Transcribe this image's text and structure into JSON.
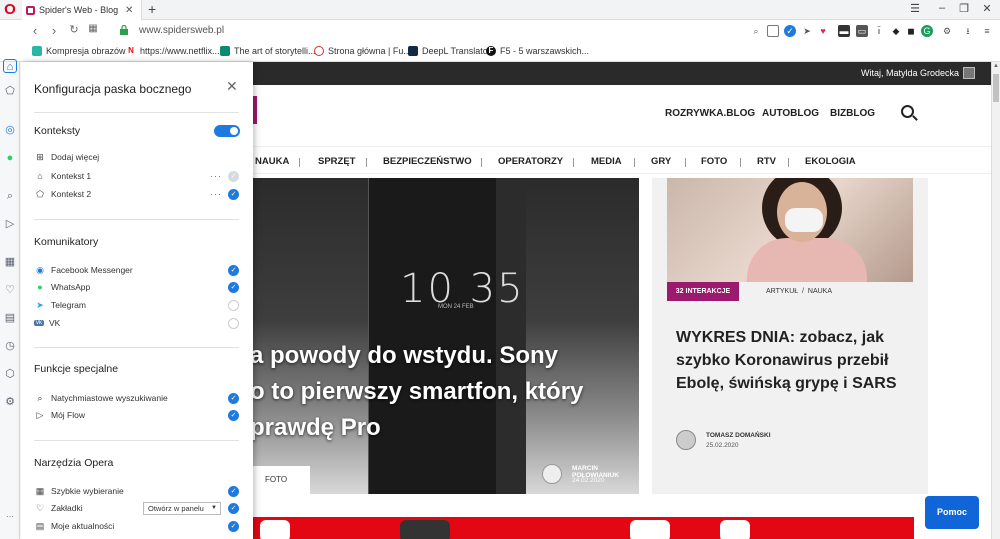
{
  "browser": {
    "tab_title": "Spider's Web - Blog Blisko",
    "url": "www.spidersweb.pl",
    "brand_color": "#e0001b"
  },
  "bookmarks": [
    {
      "label": "Kompresja obrazów...",
      "icon": "cloud-icon",
      "color": "#2bb5a6"
    },
    {
      "label": "https://www.netflix....",
      "icon": "netflix-icon",
      "color": "#e50914"
    },
    {
      "label": "The art of storytelli...",
      "icon": "leaf-icon",
      "color": "#0a8a6f"
    },
    {
      "label": "Strona główna | Fu...",
      "icon": "circle-icon",
      "color": "#d32f2f"
    },
    {
      "label": "DeepL Translator",
      "icon": "deepl-icon",
      "color": "#0f2b46"
    },
    {
      "label": "F5 - 5 warszawskich...",
      "icon": "f5-icon",
      "color": "#111"
    }
  ],
  "sidebar_panel": {
    "title": "Konfiguracja paska bocznego",
    "sections": {
      "contexts": {
        "title": "Konteksty",
        "toggle_on": true,
        "add_more": "Dodaj więcej",
        "items": [
          {
            "label": "Kontekst 1",
            "checked": false
          },
          {
            "label": "Kontekst 2",
            "checked": true
          }
        ]
      },
      "messengers": {
        "title": "Komunikatory",
        "items": [
          {
            "label": "Facebook Messenger",
            "checked": true
          },
          {
            "label": "WhatsApp",
            "checked": true
          },
          {
            "label": "Telegram",
            "checked": false
          },
          {
            "label": "VK",
            "checked": false
          }
        ]
      },
      "special": {
        "title": "Funkcje specjalne",
        "items": [
          {
            "label": "Natychmiastowe wyszukiwanie",
            "checked": true
          },
          {
            "label": "Mój Flow",
            "checked": true
          }
        ]
      },
      "tools": {
        "title": "Narzędzia Opera",
        "items": [
          {
            "label": "Szybkie wybieranie",
            "checked": true
          },
          {
            "label": "Zakładki",
            "checked": true,
            "select": "Otwórz w panelu"
          },
          {
            "label": "Moje aktualności",
            "checked": true
          }
        ]
      }
    }
  },
  "site": {
    "greeting": "Witaj, Matylda Grodecka",
    "top_links": [
      "ROZRYWKA.BLOG",
      "AUTOBLOG",
      "BIZBLOG"
    ],
    "categories": [
      "NAUKA",
      "SPRZĘT",
      "BEZPIECZEŃSTWO",
      "OPERATORZY",
      "MEDIA",
      "GRY",
      "FOTO",
      "RTV",
      "EKOLOGIA"
    ],
    "hero": {
      "title": "a powody do wstydu. Sony o to pierwszy smartfon, który prawdę Pro",
      "lines": [
        "a powody do wstydu. Sony",
        "o to pierwszy smartfon, który",
        "prawdę Pro"
      ],
      "tag": "FOTO",
      "author": "MARCIN POŁOWIANIUK",
      "date": "24.02.2020",
      "clock": "10 35",
      "clock_date": "MON 24 FEB"
    },
    "side_article": {
      "badge": "32 INTERAKCJE",
      "crumb": "ARTYKUŁ  /  NAUKA",
      "title": "WYKRES DNIA: zobacz, jak szybko Koronawirus przebił Ebolę, świńską grypę i SARS",
      "author": "TOMASZ DOMAŃSKI",
      "date": "25.02.2020"
    },
    "help_button": "Pomoc",
    "accent_color": "#9c1a6d"
  }
}
